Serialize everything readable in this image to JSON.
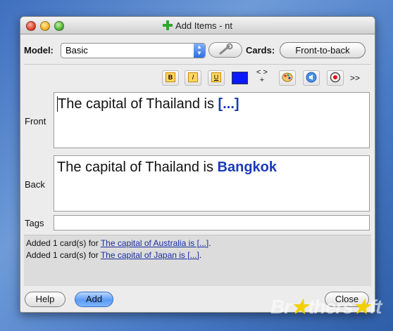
{
  "window": {
    "title": "Add Items - nt"
  },
  "model": {
    "label": "Model:",
    "value": "Basic"
  },
  "cards": {
    "label": "Cards:",
    "button": "Front-to-back"
  },
  "toolbar": {
    "bold": "B",
    "italic": "I",
    "underline": "U",
    "more": ">>",
    "cloze": "< >\n+",
    "color": "#0a1aff",
    "icons": [
      "bold-icon",
      "italic-icon",
      "underline-icon",
      "text-color-swatch",
      "cloze-icon",
      "palette-icon",
      "sound-icon",
      "record-icon",
      "more-icon"
    ]
  },
  "fields": {
    "front": {
      "label": "Front",
      "text": "The capital of Thailand is ",
      "highlight": "[...]"
    },
    "back": {
      "label": "Back",
      "text": "The capital of Thailand is ",
      "highlight": "Bangkok"
    },
    "tags": {
      "label": "Tags",
      "value": ""
    }
  },
  "status": {
    "lines": [
      {
        "prefix": "Added 1 card(s) for ",
        "link": "The capital of Australia is [...]",
        "suffix": "."
      },
      {
        "prefix": "Added 1 card(s) for ",
        "link": "The capital of Japan is [...]",
        "suffix": "."
      }
    ]
  },
  "buttons": {
    "help": "Help",
    "add": "Add",
    "close": "Close"
  },
  "watermark": "Br thers ft"
}
